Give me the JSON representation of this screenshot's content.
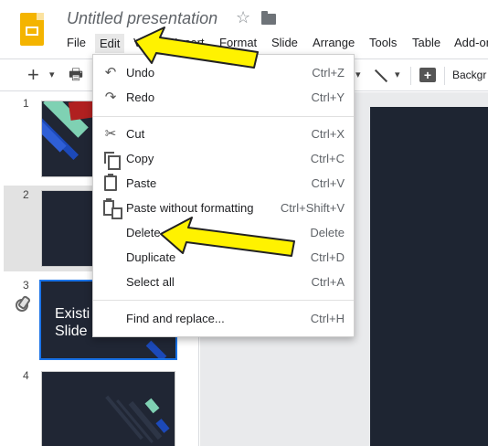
{
  "header": {
    "doc_title": "Untitled presentation",
    "star_glyph": "☆",
    "menu": [
      "File",
      "Edit",
      "View",
      "Insert",
      "Format",
      "Slide",
      "Arrange",
      "Tools",
      "Table",
      "Add-ons"
    ]
  },
  "toolbar": {
    "new_glyph": "+",
    "dropdown_glyph": "▾",
    "print_glyph": "🖶",
    "comment_glyph": "+",
    "background_label": "Backgr"
  },
  "filmstrip": {
    "slides": [
      {
        "number": "1"
      },
      {
        "number": "2"
      },
      {
        "number": "3",
        "text_line1": "Existi",
        "text_line2": "Slide"
      },
      {
        "number": "4"
      }
    ]
  },
  "edit_menu": {
    "items": [
      {
        "label": "Undo",
        "shortcut": "Ctrl+Z",
        "icon": "undo-icon",
        "glyph": "↶"
      },
      {
        "label": "Redo",
        "shortcut": "Ctrl+Y",
        "icon": "redo-icon",
        "glyph": "↷"
      },
      {
        "label": "Cut",
        "shortcut": "Ctrl+X",
        "icon": "cut-icon",
        "glyph": "✂"
      },
      {
        "label": "Copy",
        "shortcut": "Ctrl+C",
        "icon": "copy-icon"
      },
      {
        "label": "Paste",
        "shortcut": "Ctrl+V",
        "icon": "paste-icon"
      },
      {
        "label": "Paste without formatting",
        "shortcut": "Ctrl+Shift+V",
        "icon": "paste-plain-icon"
      },
      {
        "label": "Delete",
        "shortcut": "Delete"
      },
      {
        "label": "Duplicate",
        "shortcut": "Ctrl+D"
      },
      {
        "label": "Select all",
        "shortcut": "Ctrl+A"
      },
      {
        "label": "Find and replace...",
        "shortcut": "Ctrl+H"
      }
    ]
  },
  "colors": {
    "accent": "#1a73e8",
    "slide_bg": "#202634",
    "annotation_arrow": "#fff200",
    "logo": "#f4b400"
  }
}
